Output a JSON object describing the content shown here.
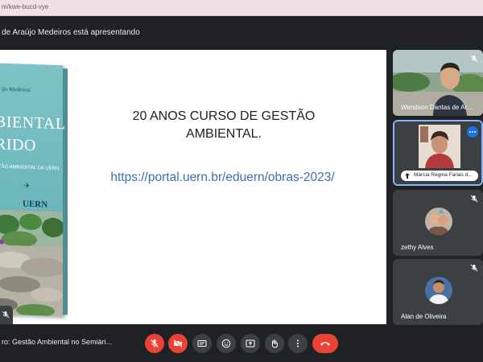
{
  "browser": {
    "url_fragment": "m/kwe-bucd-vye"
  },
  "banner": {
    "text": "de Araújo Medeiros está apresentando"
  },
  "slide": {
    "title": "20 ANOS CURSO DE GESTÃO AMBIENTAL.",
    "link": "https://portal.uern.br/eduern/obras-2023/",
    "book": {
      "author_text": "ijo Medeiros",
      "title_line1": "BIENTAL",
      "title_line2": "RIDO",
      "subtitle_text": "TÃO AMBIENTAL DA UERN",
      "publisher": "UERN"
    }
  },
  "participants": [
    {
      "name": "Wendson Dantas de Ar...",
      "mic": "muted"
    },
    {
      "name": "Márcia Regina Farias d...",
      "mic": "on",
      "pinned": true
    },
    {
      "name": "zethy Alves",
      "mic": "muted"
    },
    {
      "name": "Alan de Oliveira",
      "mic": "muted"
    }
  ],
  "meeting": {
    "title": "ro: Gestão Ambiental no Semiári..."
  },
  "colors": {
    "accent": "#8ab4f8",
    "danger": "#ea4335",
    "surface": "#3c4043",
    "background": "#202124"
  },
  "controls": [
    {
      "name": "mic-off-button",
      "icon": "mic-off-icon"
    },
    {
      "name": "camera-off-button",
      "icon": "camera-off-icon"
    },
    {
      "name": "captions-button",
      "icon": "captions-icon"
    },
    {
      "name": "emoji-button",
      "icon": "emoji-icon"
    },
    {
      "name": "present-button",
      "icon": "present-icon"
    },
    {
      "name": "raise-hand-button",
      "icon": "hand-icon"
    },
    {
      "name": "more-options-button",
      "icon": "more-vert-icon"
    },
    {
      "name": "hang-up-button",
      "icon": "phone-hangup-icon"
    }
  ]
}
